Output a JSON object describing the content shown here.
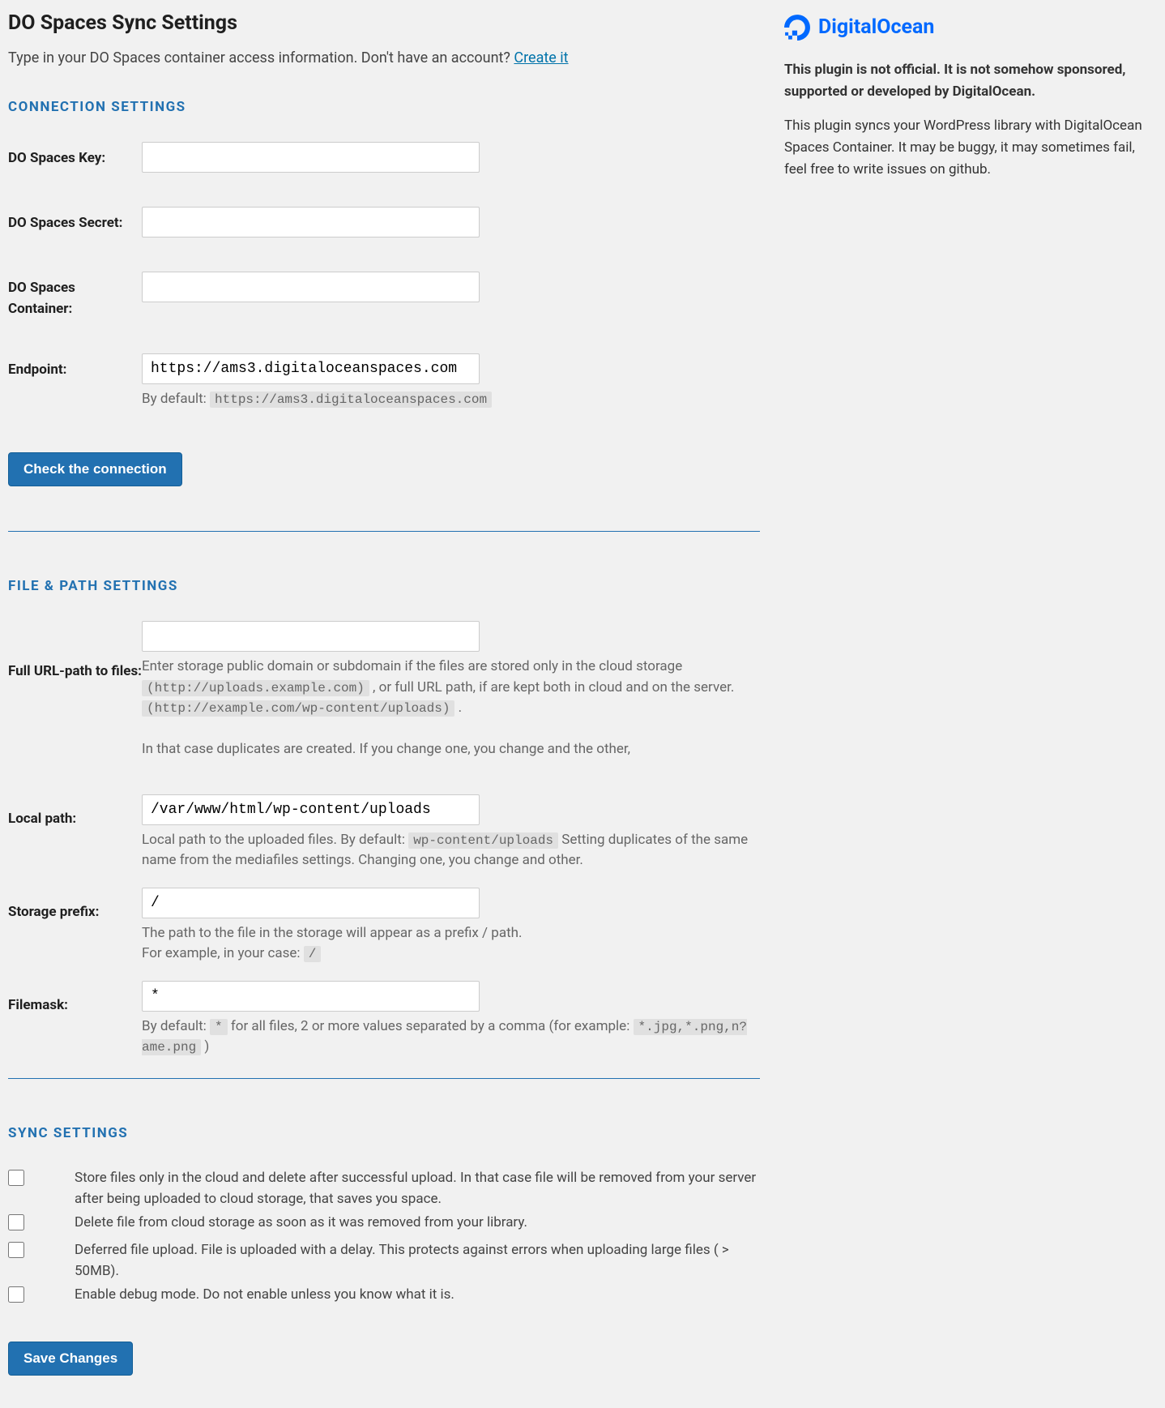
{
  "header": {
    "title": "DO Spaces Sync Settings",
    "intro_text": "Type in your DO Spaces container access information. Don't have an account? ",
    "create_link": "Create it"
  },
  "connection": {
    "section_title": "CONNECTION SETTINGS",
    "key_label": "DO Spaces Key:",
    "key_value": "",
    "secret_label": "DO Spaces Secret:",
    "secret_value": "",
    "container_label": "DO Spaces Container:",
    "container_value": "",
    "endpoint_label": "Endpoint:",
    "endpoint_value": "https://ams3.digitaloceanspaces.com",
    "endpoint_desc_prefix": "By default: ",
    "endpoint_default": "https://ams3.digitaloceanspaces.com",
    "check_button": "Check the connection"
  },
  "filepath": {
    "section_title": "FILE & PATH SETTINGS",
    "urlpath_label": "Full URL-path to files:",
    "urlpath_value": "",
    "urlpath_desc1": "Enter storage public domain or subdomain if the files are stored only in the cloud storage ",
    "urlpath_code1": "(http://uploads.example.com)",
    "urlpath_desc2": " , or full URL path, if are kept both in cloud and on the server. ",
    "urlpath_code2": "(http://example.com/wp-content/uploads)",
    "urlpath_desc3": " .",
    "urlpath_desc4": "In that case duplicates are created. If you change one, you change and the other,",
    "localpath_label": "Local path:",
    "localpath_value": "/var/www/html/wp-content/uploads",
    "localpath_desc1": "Local path to the uploaded files. By default: ",
    "localpath_code": "wp-content/uploads",
    "localpath_desc2": " Setting duplicates of the same name from the mediafiles settings. Changing one, you change and other.",
    "prefix_label": "Storage prefix:",
    "prefix_value": "/",
    "prefix_desc1": "The path to the file in the storage will appear as a prefix / path.",
    "prefix_desc2": "For example, in your case: ",
    "prefix_code": "/",
    "filemask_label": "Filemask:",
    "filemask_value": "*",
    "filemask_desc1": "By default: ",
    "filemask_code1": "*",
    "filemask_desc2": " for all files, 2 or more values separated by a comma (for example: ",
    "filemask_code2": "*.jpg,*.png,n?ame.png",
    "filemask_desc3": " )"
  },
  "sync": {
    "section_title": "SYNC SETTINGS",
    "opt1": "Store files only in the cloud and delete after successful upload. In that case file will be removed from your server after being uploaded to cloud storage, that saves you space.",
    "opt2": "Delete file from cloud storage as soon as it was removed from your library.",
    "opt3": "Deferred file upload. File is uploaded with a delay. This protects against errors when uploading large files ( > 50MB).",
    "opt4": "Enable debug mode. Do not enable unless you know what it is.",
    "save_button": "Save Changes"
  },
  "aside": {
    "brand": "DigitalOcean",
    "disclaimer": "This plugin is not official. It is not somehow sponsored, supported or developed by DigitalOcean.",
    "description": "This plugin syncs your WordPress library with DigitalOcean Spaces Container. It may be buggy, it may sometimes fail, feel free to write issues on github."
  }
}
